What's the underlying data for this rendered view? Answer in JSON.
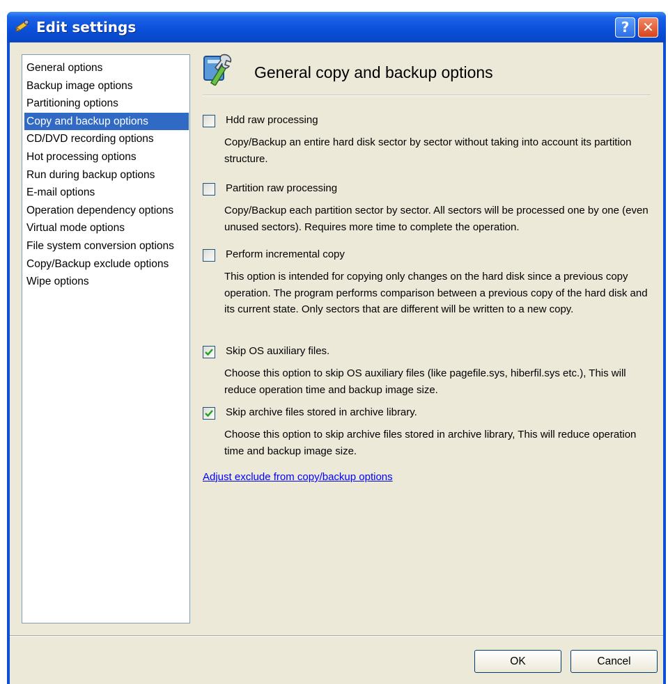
{
  "window": {
    "title": "Edit settings",
    "help_label": "?",
    "close_label": "✕"
  },
  "sidebar": {
    "items": [
      {
        "label": "General options"
      },
      {
        "label": "Backup image options"
      },
      {
        "label": "Partitioning options"
      },
      {
        "label": "Copy and backup options",
        "selected": true
      },
      {
        "label": "CD/DVD recording options"
      },
      {
        "label": "Hot processing options"
      },
      {
        "label": "Run during backup options"
      },
      {
        "label": "E-mail options"
      },
      {
        "label": "Operation dependency options"
      },
      {
        "label": "Virtual mode options"
      },
      {
        "label": "File system conversion options"
      },
      {
        "label": "Copy/Backup exclude options"
      },
      {
        "label": "Wipe options"
      }
    ]
  },
  "page": {
    "title": "General copy and backup options",
    "icon": "settings-tools-icon"
  },
  "options": [
    {
      "label": "Hdd raw processing",
      "checked": false,
      "description": "Copy/Backup an entire hard disk sector by sector without taking into account its partition structure."
    },
    {
      "label": "Partition raw processing",
      "checked": false,
      "description": "Copy/Backup each partition sector by sector. All sectors will be processed one by one (even unused sectors). Requires more time to complete the operation."
    },
    {
      "label": "Perform incremental copy",
      "checked": false,
      "description": "This option is intended for copying only changes on the hard disk since a previous copy operation. The program performs comparison between a previous copy of the hard disk and its current state. Only sectors that are different will be written to a new copy."
    },
    {
      "label": "Skip OS auxiliary files.",
      "checked": true,
      "description": "Choose this option to skip OS auxiliary files (like pagefile.sys, hiberfil.sys etc.), This will reduce operation time and backup image size."
    },
    {
      "label": "Skip archive files stored in archive library.",
      "checked": true,
      "description": "Choose this option to skip archive files stored in archive library, This will reduce operation time and backup image size."
    }
  ],
  "link": {
    "label": "Adjust exclude from copy/backup options"
  },
  "buttons": {
    "ok": "OK",
    "cancel": "Cancel"
  },
  "colors": {
    "titlebar": "#0a4fd8",
    "selection": "#316ac5",
    "dialog_bg": "#ece9d8",
    "link": "#0000ff"
  }
}
